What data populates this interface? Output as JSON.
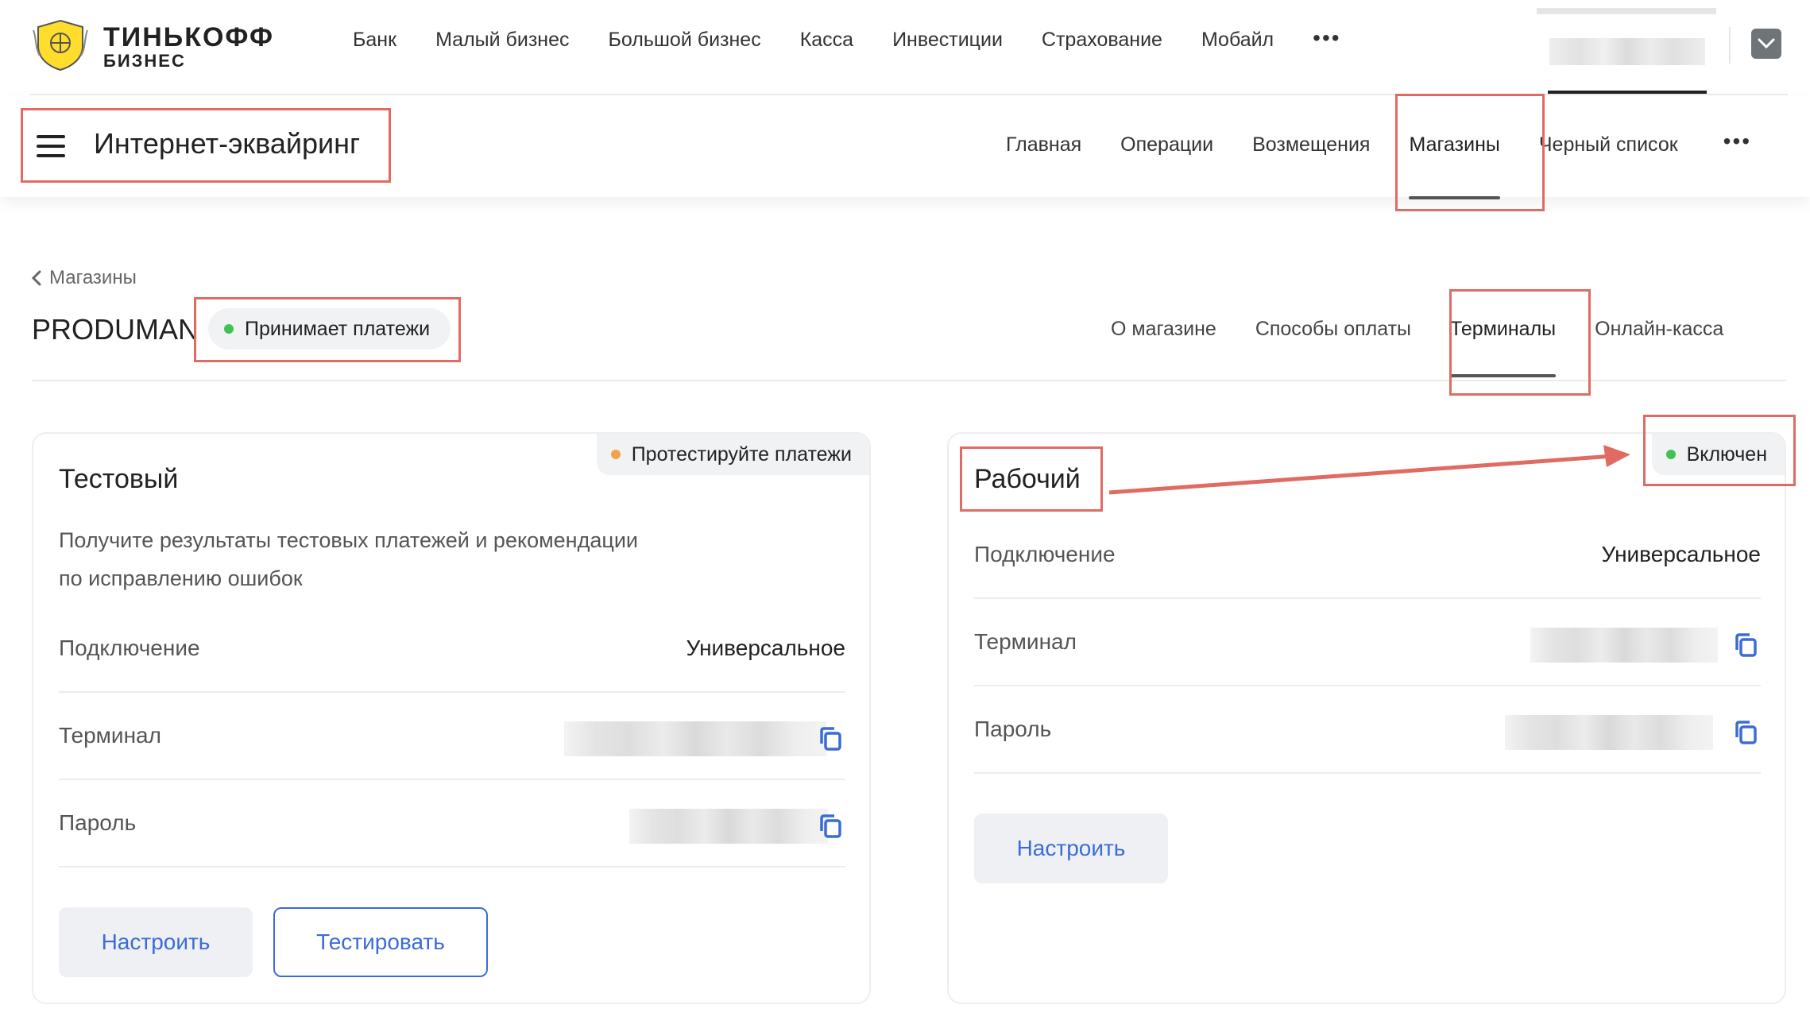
{
  "logo": {
    "line1": "ТИНЬКОФФ",
    "line2": "БИЗНЕС"
  },
  "topnav": {
    "items": [
      "Банк",
      "Малый бизнес",
      "Большой бизнес",
      "Касса",
      "Инвестиции",
      "Страхование",
      "Мобайл"
    ],
    "more": "•••"
  },
  "subbar": {
    "title": "Интернет-эквайринг",
    "tabs": [
      "Главная",
      "Операции",
      "Возмещения",
      "Магазины",
      "Черный список"
    ],
    "active_tab": "Магазины",
    "more": "•••"
  },
  "breadcrumb": {
    "label": "Магазины"
  },
  "store": {
    "name": "PRODUMAN",
    "status": "Принимает платежи",
    "tabs": [
      "О магазине",
      "Способы оплаты",
      "Терминалы",
      "Онлайн-касса"
    ],
    "active_tab": "Терминалы"
  },
  "test_terminal": {
    "badge": "Протестируйте платежи",
    "title": "Тестовый",
    "description_line1": "Получите результаты тестовых платежей и рекомендации",
    "description_line2": "по исправлению ошибок",
    "connection_label": "Подключение",
    "connection_value": "Универсальное",
    "terminal_label": "Терминал",
    "password_label": "Пароль",
    "configure_button": "Настроить",
    "test_button": "Тестировать"
  },
  "work_terminal": {
    "badge": "Включен",
    "title": "Рабочий",
    "connection_label": "Подключение",
    "connection_value": "Универсальное",
    "terminal_label": "Терминал",
    "password_label": "Пароль",
    "configure_button": "Настроить"
  },
  "colors": {
    "accent_blue": "#3b6cd6",
    "status_green": "#44c153",
    "status_orange": "#f2a24a",
    "highlight_red": "#e06b63"
  }
}
